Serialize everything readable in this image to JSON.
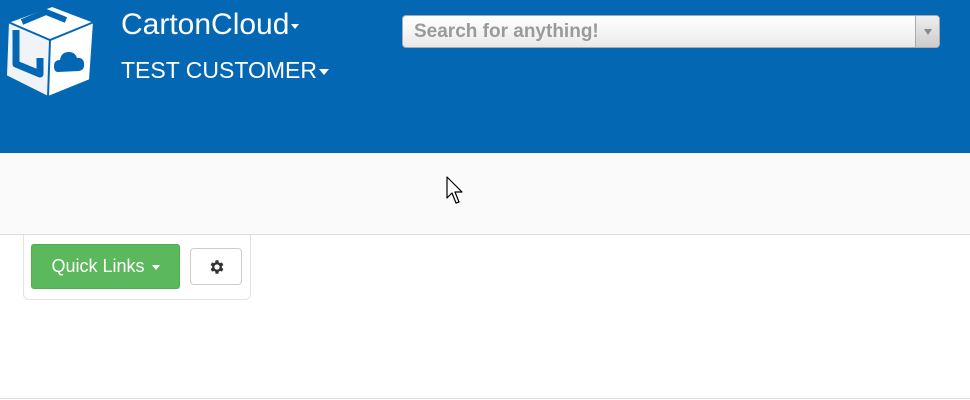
{
  "header": {
    "background": "#0467b3",
    "logo": "cartoncloud-box-logo",
    "app_name": "CartonCloud",
    "customer_name": "TEST CUSTOMER",
    "search": {
      "placeholder": "Search for anything!",
      "value": ""
    }
  },
  "toolbar": {
    "quick_links_label": "Quick Links",
    "quick_links_color": "#5cb85c",
    "settings_icon": "gear-icon"
  },
  "icons": {
    "caret": "chevron-down-icon",
    "cursor": "mouse-pointer-icon"
  }
}
